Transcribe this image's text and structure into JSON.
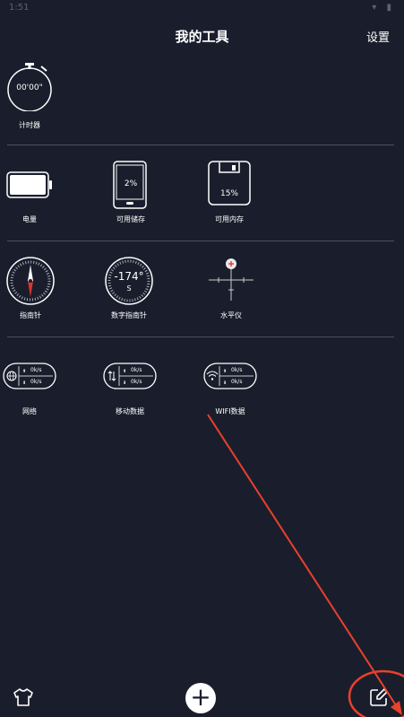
{
  "status": {
    "time": "1:51",
    "icons": "▾ ▮"
  },
  "header": {
    "title": "我的工具",
    "settings_label": "设置"
  },
  "tools": {
    "timer": {
      "label": "计时器",
      "display": "00'00\""
    },
    "battery": {
      "label": "电量"
    },
    "storage": {
      "label": "可用储存",
      "value": "2%"
    },
    "memory": {
      "label": "可用内存",
      "value": "15%"
    },
    "compass": {
      "label": "指南针"
    },
    "digital_compass": {
      "label": "数字指南针",
      "degrees": "-174°",
      "direction": "S"
    },
    "level": {
      "label": "水平仪"
    },
    "network": {
      "label": "网络",
      "up": "0k/s",
      "down": "0k/s"
    },
    "mobile_data": {
      "label": "移动数据",
      "up": "0k/s",
      "down": "0k/s"
    },
    "wifi_data": {
      "label": "WIFI数据",
      "up": "0k/s",
      "down": "0k/s"
    }
  },
  "bottom": {
    "plus_label": "+"
  },
  "icons": {
    "shirt": "shirt-icon",
    "plus": "plus-icon",
    "edit": "edit-icon",
    "globe": "globe-icon",
    "transfer": "transfer-icon",
    "wifi": "wifi-icon"
  },
  "colors": {
    "background": "#1a1e2c",
    "divider": "#4a4f60",
    "annotation": "#e8412c",
    "compass_needle": "#d9362b"
  }
}
